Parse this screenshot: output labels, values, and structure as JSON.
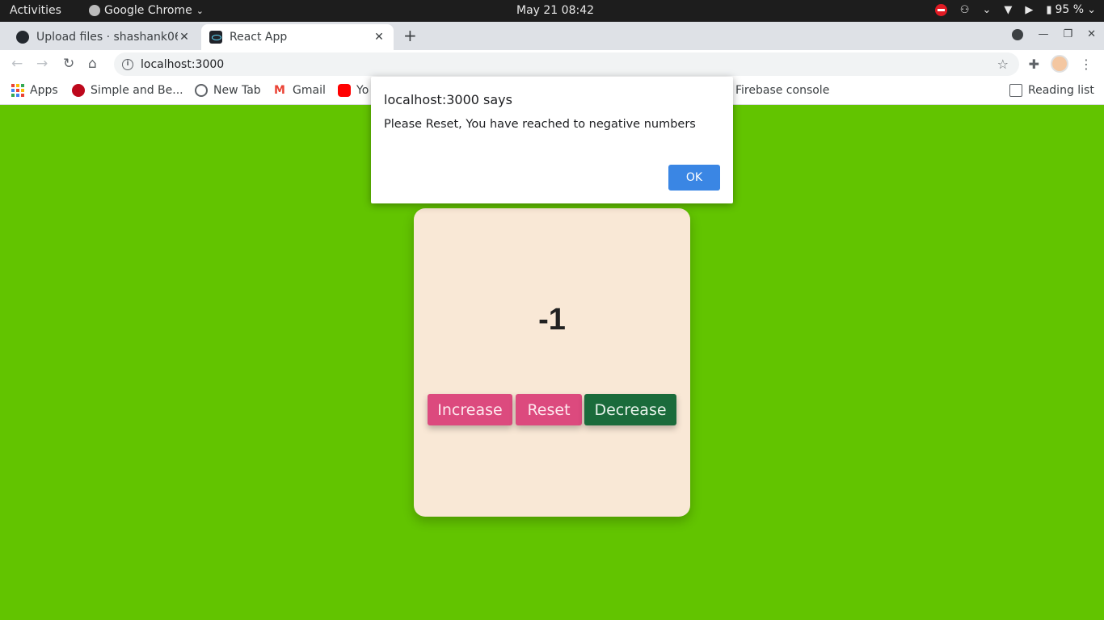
{
  "system_bar": {
    "activities": "Activities",
    "app_name": "Google Chrome",
    "clock": "May 21  08:42",
    "battery": "95 %"
  },
  "tabs": [
    {
      "title": "Upload files · shashank06",
      "icon": "github-icon"
    },
    {
      "title": "React App",
      "icon": "react-icon"
    }
  ],
  "address_bar": {
    "url": "localhost:3000"
  },
  "bookmarks": [
    {
      "label": "Apps",
      "icon": "apps-grid-icon"
    },
    {
      "label": "Simple and Be...",
      "icon": "pinterest-icon"
    },
    {
      "label": "New Tab",
      "icon": "globe-icon"
    },
    {
      "label": "Gmail",
      "icon": "gmail-icon"
    },
    {
      "label": "Yo",
      "icon": "youtube-icon"
    },
    {
      "label": "Firebase console",
      "icon": ""
    },
    {
      "label": "Reading list",
      "icon": "reading-list-icon"
    }
  ],
  "counter": {
    "value": "-1",
    "increase_label": "Increase",
    "reset_label": "Reset",
    "decrease_label": "Decrease"
  },
  "alert": {
    "title": "localhost:3000 says",
    "message": "Please Reset, You have reached to negative numbers",
    "ok_label": "OK"
  },
  "colors": {
    "page_background": "#62c400",
    "card_background": "#f9e8d6",
    "pink_button": "#dc4a7e",
    "green_button": "#1a6b3b",
    "ok_button": "#3a86e4"
  }
}
